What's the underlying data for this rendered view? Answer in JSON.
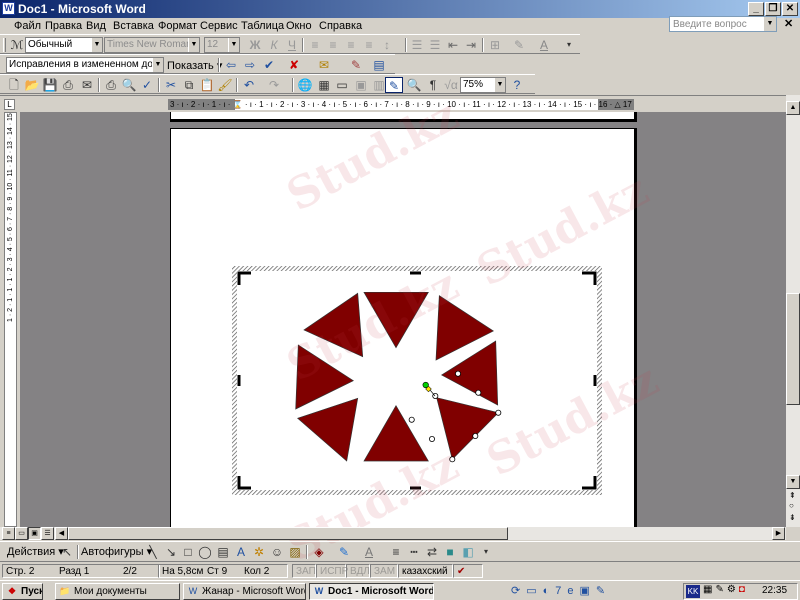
{
  "window": {
    "title": "Doc1 - Microsoft Word",
    "minimize": "_",
    "restore": "❐",
    "close": "✕"
  },
  "menu": [
    "Файл",
    "Правка",
    "Вид",
    "Вставка",
    "Формат",
    "Сервис",
    "Таблица",
    "Окно",
    "Справка"
  ],
  "help": {
    "placeholder": "Введите вопрос",
    "close": "✕"
  },
  "formatting": {
    "style": "Обычный",
    "font": "Times New Roman",
    "size": "12",
    "bold": "Ж",
    "italic": "К",
    "underline": "Ч"
  },
  "reviewing": {
    "display_mode": "Исправления в измененном докумен",
    "show_label": "Показать ▾"
  },
  "standard": {
    "zoom": "75%"
  },
  "ruler": {
    "text": "3 · ı · 2 · ı · 1 · ı · ⌛ · ı · 1 · ı · 2 · ı · 3 · ı · 4 · ı · 5 · ı · 6 · ı · 7 · ı · 8 · ı · 9 · ı · 10 · ı · 11 · ı · 12 · ı · 13 · ı · 14 · ı · 15 · ı · 16 · △ 17 · ı ·"
  },
  "vruler": {
    "text": "1 · 2 · 1 · 1 · 1 · 2 · 3 · 4 · 5 · 6 · 7 · 8 · 9 · 10 · 11 · 12 · 13 · 14 · 15"
  },
  "drawing": {
    "actions": "Действия ▾",
    "autoshapes": "Автофигуры ▾"
  },
  "status": {
    "page": "Стр. 2",
    "section": "Разд 1",
    "pages": "2/2",
    "at": "На 5,8см",
    "line": "Ст 9",
    "col": "Кол 2",
    "rec": "ЗАП",
    "trk": "ИСПР",
    "ext": "ВДЛ",
    "ovr": "ЗАМ",
    "language": "казахский"
  },
  "taskbar": {
    "start": "Пуск",
    "tasks": [
      "Мои документы",
      "Жанар - Microsoft Word",
      "Doc1 - Microsoft Word"
    ],
    "lang": "KK",
    "clock": "22:35"
  },
  "shape_fill": "#800000",
  "watermark": "Stud.kz"
}
